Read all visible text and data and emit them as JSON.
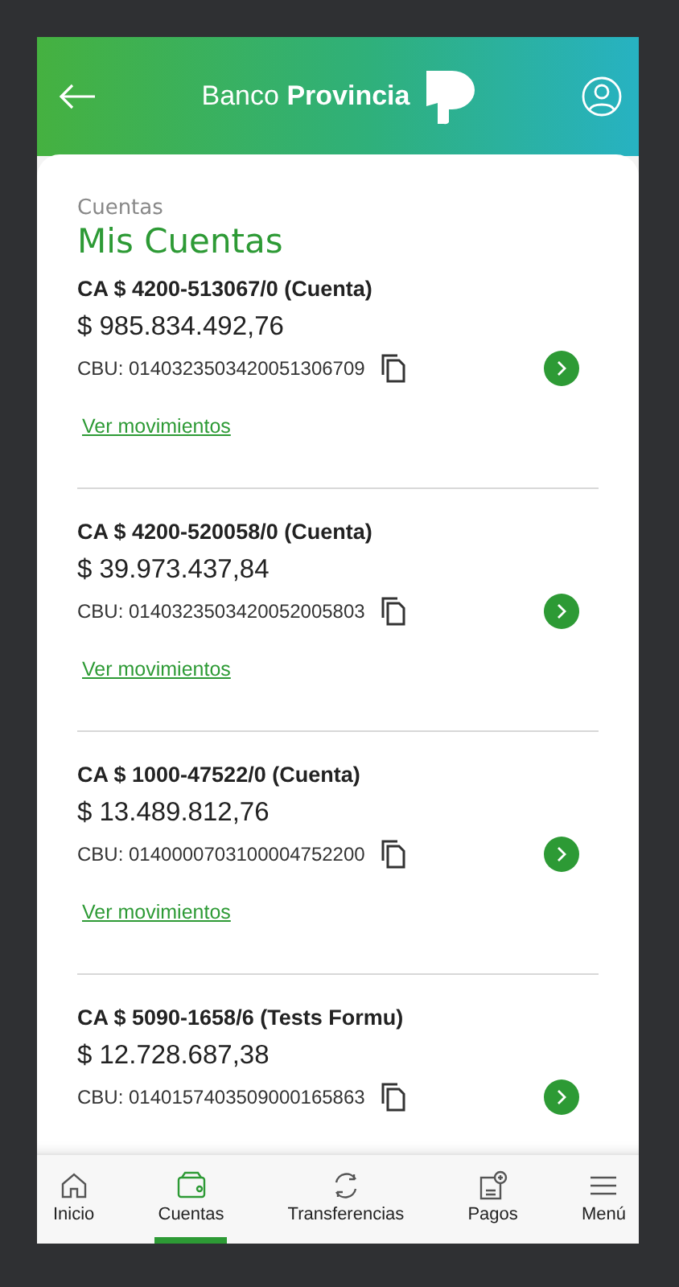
{
  "header": {
    "brand": "Banco **Provincia**"
  },
  "breadcrumb": "Cuentas",
  "title": "Mis Cuentas",
  "accounts": [
    {
      "name": "CA $ 4200-513067/0 (Cuenta)",
      "balance": "$ 985.834.492,76",
      "cbu": "CBU: 0140323503420051306709",
      "link": "Ver movimientos"
    },
    {
      "name": "CA $ 4200-520058/0 (Cuenta)",
      "balance": "$ 39.973.437,84",
      "cbu": "CBU: 0140323503420052005803",
      "link": "Ver movimientos"
    },
    {
      "name": "CA $ 1000-47522/0 (Cuenta)",
      "balance": "$ 13.489.812,76",
      "cbu": "CBU: 0140000703100004752200",
      "link": "Ver movimientos"
    },
    {
      "name": "CA $ 5090-1658/6 (Tests Formu)",
      "balance": "$ 12.728.687,38",
      "cbu": "CBU: 0140157403509000165863"
    }
  ],
  "nav": [
    {
      "kind": "home",
      "label": "Inicio",
      "selected": false
    },
    {
      "kind": "wallet",
      "label": "Cuentas",
      "selected": true
    },
    {
      "kind": "transfer",
      "label": "Transferencias",
      "selected": false
    },
    {
      "kind": "pay",
      "label": "Pagos",
      "selected": false
    },
    {
      "kind": "menu",
      "label": "Menú",
      "selected": false
    }
  ]
}
